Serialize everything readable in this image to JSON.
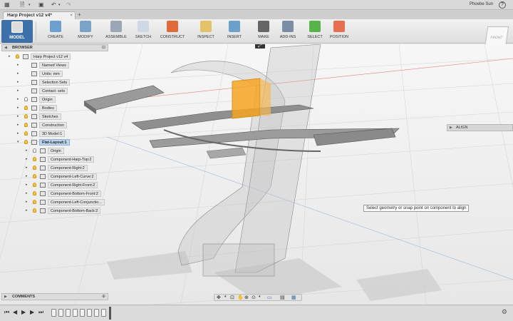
{
  "app": {
    "doc_tab_title": "Harp Project v12 v4*",
    "user_name": "Phoebe Sun",
    "help_label": "?"
  },
  "toolbar": {
    "workspace_label": "MODEL",
    "tools": [
      {
        "id": "create",
        "label": "CREATE",
        "color": "#6e9fcf"
      },
      {
        "id": "modify",
        "label": "MODIFY",
        "color": "#7ba3c8"
      },
      {
        "id": "assemble",
        "label": "ASSEMBLE",
        "color": "#9aa7b4"
      },
      {
        "id": "sketch",
        "label": "SKETCH",
        "color": "#cfd9e6"
      },
      {
        "id": "construct",
        "label": "CONSTRUCT",
        "color": "#e06a3c"
      },
      {
        "id": "inspect",
        "label": "INSPECT",
        "color": "#e3c26a"
      },
      {
        "id": "insert",
        "label": "INSERT",
        "color": "#6aa0c9"
      },
      {
        "id": "make",
        "label": "MAKE",
        "color": "#666666"
      },
      {
        "id": "addins",
        "label": "ADD-INS",
        "color": "#7a8ea3"
      },
      {
        "id": "select",
        "label": "SELECT",
        "color": "#58b34a"
      },
      {
        "id": "position",
        "label": "POSITION",
        "color": "#e76f51"
      }
    ]
  },
  "viewcube": {
    "label": "FRONT"
  },
  "browser": {
    "title": "BROWSER",
    "items": [
      {
        "label": "Harp Project v12 v4",
        "depth": 0,
        "bulb": "on",
        "active": false
      },
      {
        "label": "Named Views",
        "depth": 1,
        "bulb": "none",
        "active": false
      },
      {
        "label": "Units: mm",
        "depth": 1,
        "bulb": "none",
        "active": false
      },
      {
        "label": "Selection Sets",
        "depth": 1,
        "bulb": "none",
        "active": false
      },
      {
        "label": "Contact: sets",
        "depth": 1,
        "bulb": "none",
        "active": false
      },
      {
        "label": "Origin",
        "depth": 1,
        "bulb": "off",
        "active": false
      },
      {
        "label": "Bodies",
        "depth": 1,
        "bulb": "on",
        "active": false
      },
      {
        "label": "Sketches",
        "depth": 1,
        "bulb": "on",
        "active": false
      },
      {
        "label": "Construction",
        "depth": 1,
        "bulb": "on",
        "active": false
      },
      {
        "label": "3D Model:1",
        "depth": 1,
        "bulb": "on",
        "active": false
      },
      {
        "label": "Flat-Layout:1",
        "depth": 1,
        "bulb": "on",
        "active": true
      },
      {
        "label": "Origin",
        "depth": 2,
        "bulb": "off",
        "active": false
      },
      {
        "label": "Component-Harp-Top:2",
        "depth": 2,
        "bulb": "on",
        "active": false
      },
      {
        "label": "Component-Right:2",
        "depth": 2,
        "bulb": "on",
        "active": false
      },
      {
        "label": "Component-Left-Curve:2",
        "depth": 2,
        "bulb": "on",
        "active": false
      },
      {
        "label": "Component-Right-Front:2",
        "depth": 2,
        "bulb": "on",
        "active": false
      },
      {
        "label": "Component-Bottom-Front:2",
        "depth": 2,
        "bulb": "on",
        "active": false
      },
      {
        "label": "Component-Left-Conjunctio...",
        "depth": 2,
        "bulb": "on",
        "active": false
      },
      {
        "label": "Component-Bottom-Back:2",
        "depth": 2,
        "bulb": "on",
        "active": false
      }
    ]
  },
  "comments": {
    "title": "COMMENTS"
  },
  "align_panel": {
    "title": "ALIGN"
  },
  "tooltip": {
    "text": "Select geometry or snap point on component to align"
  },
  "colors": {
    "selection_orange": "#f5a623",
    "active_blue": "#3d6fa8"
  }
}
